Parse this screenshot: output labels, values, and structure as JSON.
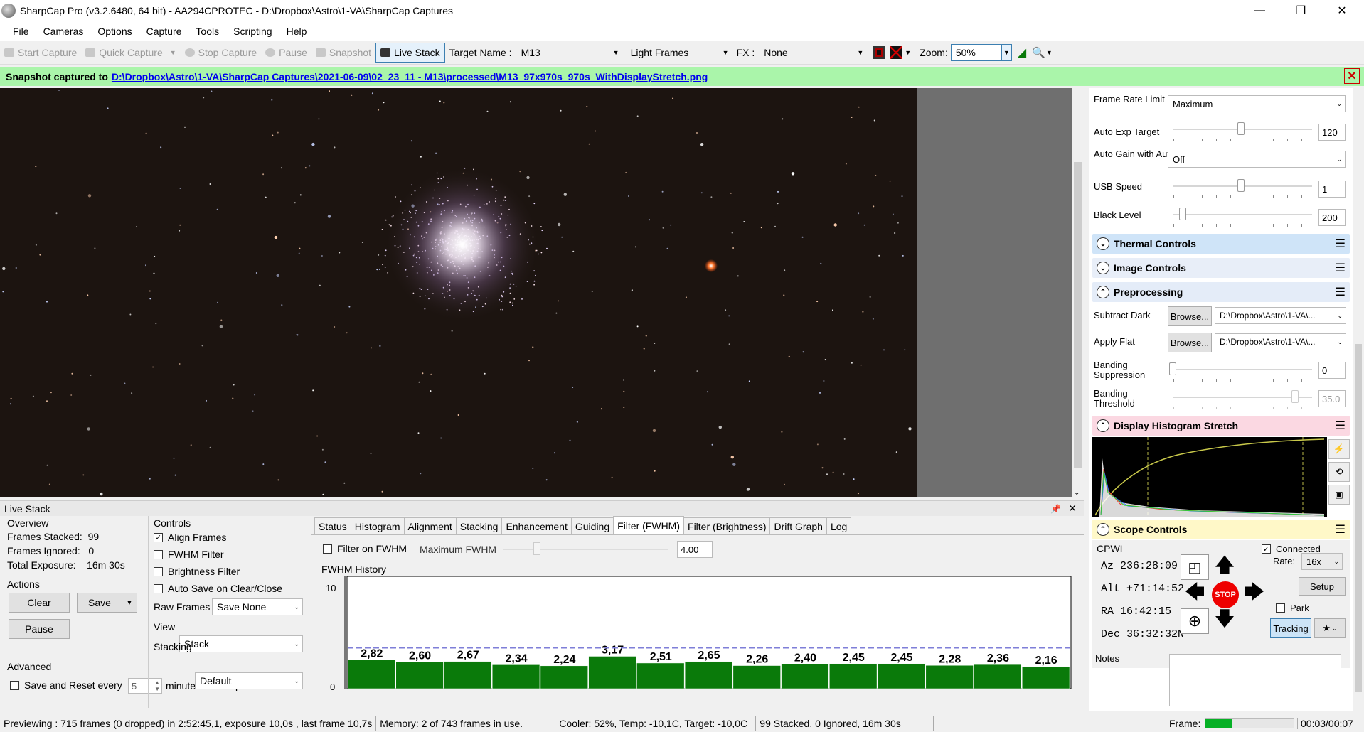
{
  "window": {
    "title": "SharpCap Pro (v3.2.6480, 64 bit) - AA294CPROTEC - D:\\Dropbox\\Astro\\1-VA\\SharpCap Captures",
    "minimize": "—",
    "maximize": "❐",
    "close": "✕"
  },
  "menu": [
    "File",
    "Cameras",
    "Options",
    "Capture",
    "Tools",
    "Scripting",
    "Help"
  ],
  "toolbar": {
    "start_capture": "Start Capture",
    "quick_capture": "Quick Capture",
    "stop_capture": "Stop Capture",
    "pause": "Pause",
    "snapshot": "Snapshot",
    "live_stack": "Live Stack",
    "target_name_label": "Target Name :",
    "target_name": "M13",
    "frame_type": "Light Frames",
    "fx_label": "FX :",
    "fx_value": "None",
    "zoom_label": "Zoom:",
    "zoom_value": "50%"
  },
  "notice": {
    "prefix": "Snapshot captured to",
    "path": "D:\\Dropbox\\Astro\\1-VA\\SharpCap Captures\\2021-06-09\\02_23_11 - M13\\processed\\M13_97x970s_970s_WithDisplayStretch.png",
    "close": "✕"
  },
  "camera_controls": {
    "frame_rate_label": "Frame Rate Limit",
    "frame_rate_value": "Maximum",
    "auto_exp_label": "Auto Exp Target",
    "auto_exp_value": "120",
    "auto_gain_label": "Auto Gain with Auto Exposure",
    "auto_gain_value": "Off",
    "usb_label": "USB Speed",
    "usb_value": "1",
    "black_label": "Black Level",
    "black_value": "200"
  },
  "groups": {
    "thermal": "Thermal Controls",
    "image": "Image Controls",
    "preprocessing": "Preprocessing",
    "histogram": "Display Histogram Stretch",
    "scope": "Scope Controls"
  },
  "preprocessing": {
    "subtract_dark_label": "Subtract Dark",
    "apply_flat_label": "Apply Flat",
    "browse": "Browse...",
    "dark_path": "D:\\Dropbox\\Astro\\1-VA\\...",
    "flat_path": "D:\\Dropbox\\Astro\\1-VA\\...",
    "banding_supp_label": "Banding Suppression",
    "banding_supp_value": "0",
    "banding_thr_label": "Banding Threshold",
    "banding_thr_value": "35.0"
  },
  "scope": {
    "mount": "CPWI",
    "connected": "Connected",
    "rate_label": "Rate:",
    "rate_value": "16x",
    "az": "Az  236:28:09",
    "alt": "Alt +71:14:52",
    "ra": "RA  16:42:15",
    "dec": "Dec 36:32:32N",
    "stop": "STOP",
    "setup": "Setup",
    "park": "Park",
    "tracking": "Tracking",
    "notes_label": "Notes"
  },
  "livestack": {
    "title": "Live Stack",
    "overview_label": "Overview",
    "frames_stacked": "Frames Stacked:  99",
    "frames_ignored": "Frames Ignored:   0",
    "total_exposure": "Total Exposure:    16m 30s",
    "actions_label": "Actions",
    "clear": "Clear",
    "save": "Save",
    "pause": "Pause",
    "advanced_label": "Advanced",
    "save_reset": "Save and Reset every",
    "save_reset_value": "5",
    "save_reset_suffix": "minutes total exposure",
    "controls_label": "Controls",
    "align": "Align Frames",
    "fwhm_filter": "FWHM Filter",
    "brightness_filter": "Brightness Filter",
    "autosave": "Auto Save on Clear/Close",
    "raw_frames_label": "Raw Frames",
    "raw_frames_value": "Save None",
    "view_label": "View",
    "view_value": "Stack",
    "stacking_label": "Stacking",
    "stacking_value": "Default",
    "tabs": [
      "Status",
      "Histogram",
      "Alignment",
      "Stacking",
      "Enhancement",
      "Guiding",
      "Filter (FWHM)",
      "Filter (Brightness)",
      "Drift Graph",
      "Log"
    ],
    "filter_on_fwhm": "Filter on FWHM",
    "max_fwhm_label": "Maximum FWHM",
    "max_fwhm_value": "4.00",
    "fwhm_history": "FWHM History"
  },
  "chart_data": {
    "type": "bar",
    "title": "FWHM History",
    "values": [
      2.82,
      2.6,
      2.67,
      2.34,
      2.24,
      3.17,
      2.51,
      2.65,
      2.26,
      2.4,
      2.45,
      2.45,
      2.28,
      2.36,
      2.16
    ],
    "labels": [
      "2,82",
      "2,60",
      "2,67",
      "2,34",
      "2,24",
      "3,17",
      "2,51",
      "2,65",
      "2,26",
      "2,40",
      "2,45",
      "2,45",
      "2,28",
      "2,36",
      "2,16"
    ],
    "ylim": [
      0,
      11
    ],
    "yticks": [
      "10",
      "0"
    ],
    "threshold": 4.0,
    "bar_color": "#0a7a0a",
    "threshold_color": "#7f7fd8"
  },
  "status": {
    "preview": "Previewing : 715 frames (0 dropped) in 2:52:45,1, exposure 10,0s , last frame 10,7s",
    "memory": "Memory: 2 of 743 frames in use.",
    "cooler": "Cooler: 52%, Temp: -10,1C, Target: -10,0C",
    "stacked": "99 Stacked, 0 Ignored, 16m 30s",
    "frame_label": "Frame:",
    "frame_progress": 0.3,
    "time": "00:03/00:07"
  }
}
